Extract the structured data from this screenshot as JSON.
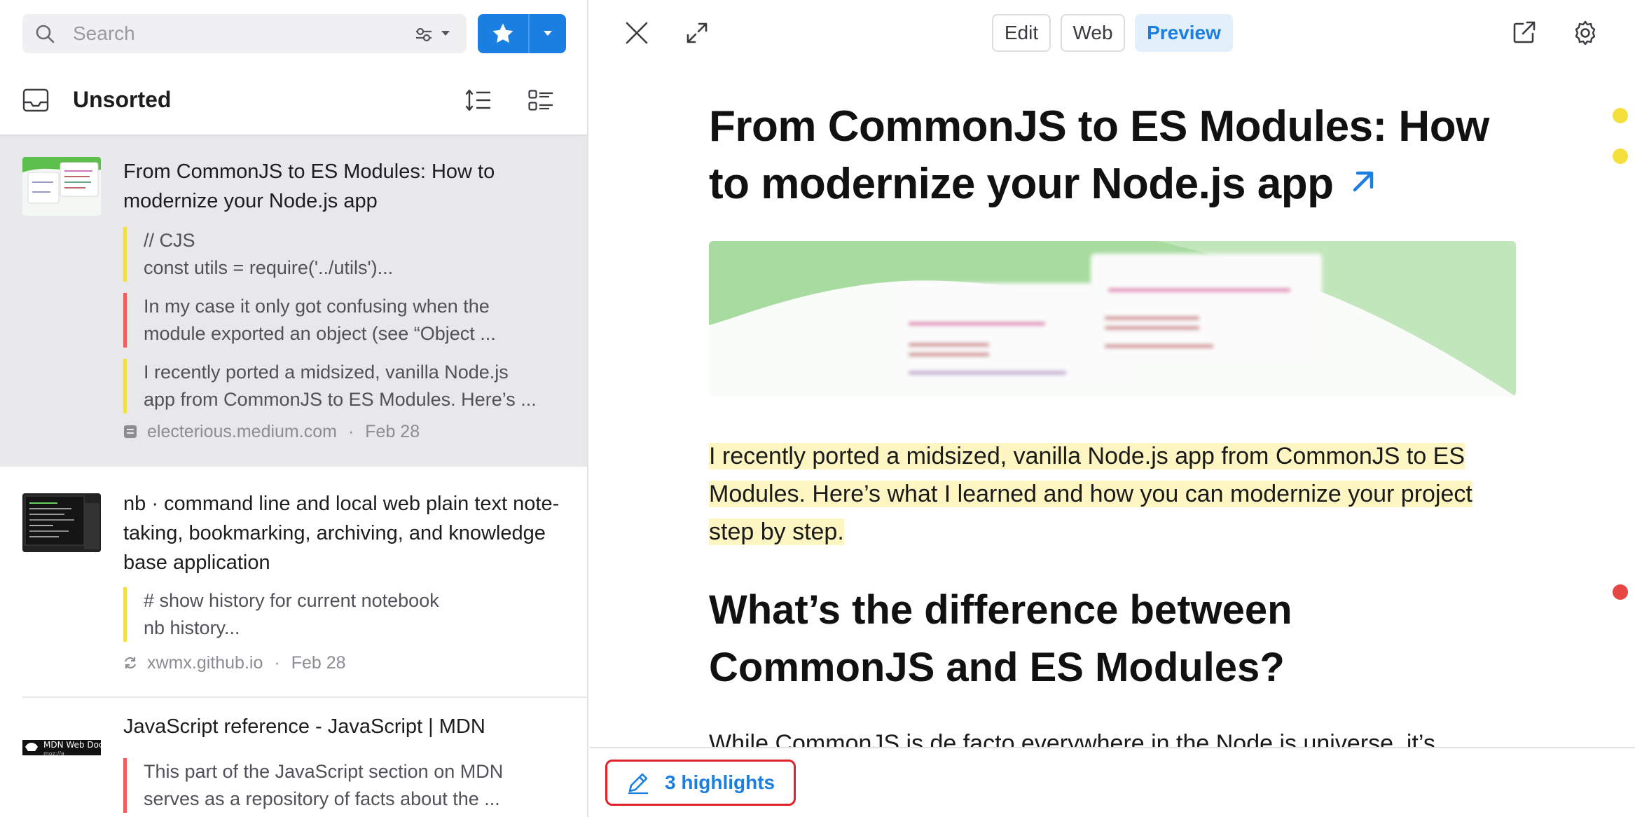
{
  "search": {
    "placeholder": "Search"
  },
  "collection": {
    "title": "Unsorted"
  },
  "items": [
    {
      "title": "From CommonJS to ES Modules: How to modernize your Node.js app",
      "highlights": [
        {
          "color": "yellow",
          "lines": [
            "// CJS",
            "const utils = require('../utils')..."
          ]
        },
        {
          "color": "red",
          "lines": [
            "In my case it only got confusing when the",
            "module exported an object (see “Object ..."
          ]
        },
        {
          "color": "yellow",
          "lines": [
            "I recently ported a midsized, vanilla Node.js",
            "app from CommonJS to ES Modules. Here’s ..."
          ]
        }
      ],
      "domain": "electerious.medium.com",
      "date": "Feb 28"
    },
    {
      "title": "nb · command line and local web plain text note-taking, bookmarking, archiving, and knowledge base application",
      "highlights": [
        {
          "color": "yellow",
          "lines": [
            "# show history for current notebook",
            "nb history..."
          ]
        }
      ],
      "domain": "xwmx.github.io",
      "date": "Feb 28"
    },
    {
      "title": "JavaScript reference - JavaScript | MDN",
      "thumb_text": "MDN Web Docs",
      "highlights": [
        {
          "color": "red",
          "lines": [
            "This part of the JavaScript section on MDN",
            "serves as a repository of facts about the ..."
          ]
        }
      ]
    }
  ],
  "modes": {
    "edit": "Edit",
    "web": "Web",
    "preview": "Preview",
    "active": "preview"
  },
  "article": {
    "title": "From CommonJS to ES Modules: How to modernize your Node.js app",
    "intro_highlighted": "I recently ported a midsized, vanilla Node.js app from CommonJS to ES Modules. Here’s what I learned and how you can modernize your project step by step.",
    "h2": "What’s the difference between CommonJS and ES Modules?",
    "para2": "While CommonJS is de facto everywhere in the Node.js universe, it’s"
  },
  "footer": {
    "highlights_label": "3 highlights"
  },
  "colors": {
    "accent": "#1a7fe0",
    "highlight_yellow": "#f1e04e",
    "highlight_red": "#ec5f5f",
    "focus_outline": "#e0222a"
  }
}
